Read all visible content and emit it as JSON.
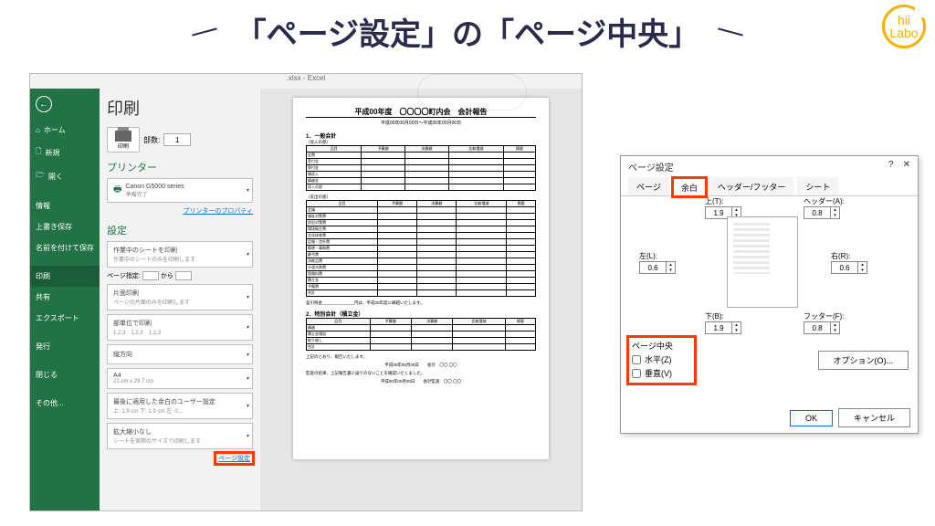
{
  "header": {
    "title": "「ページ設定」の「ページ中央」",
    "logo_text_top": "hii",
    "logo_text_bottom": "Labo"
  },
  "excel": {
    "window_title": ".xlsx - Excel",
    "sidebar": {
      "items": [
        {
          "icon": "←",
          "label": ""
        },
        {
          "label": "ホーム"
        },
        {
          "label": "新規"
        },
        {
          "label": "開く"
        },
        {
          "label": "情報"
        },
        {
          "label": "上書き保存"
        },
        {
          "label": "名前を付けて保存"
        },
        {
          "label": "印刷"
        },
        {
          "label": "共有"
        },
        {
          "label": "エクスポート"
        },
        {
          "label": "発行"
        },
        {
          "label": "閉じる"
        },
        {
          "label": "その他..."
        }
      ]
    },
    "print": {
      "title": "印刷",
      "copies_label": "部数:",
      "copies_value": "1",
      "print_button_label": "印刷",
      "printer_header": "プリンター",
      "printer_name": "Canon G5000 series",
      "printer_status": "準備完了",
      "printer_props_link": "プリンターのプロパティ",
      "settings_header": "設定",
      "settings": [
        {
          "line1": "作業中のシートを印刷",
          "line2": "作業中のシートのみを印刷します"
        },
        {
          "page_range_label1": "ページ指定:",
          "page_range_label2": "から"
        },
        {
          "line1": "片面印刷",
          "line2": "ページの片面のみを印刷します"
        },
        {
          "line1": "部単位で印刷",
          "line2": "1,2,3　1,2,3　1,2,3"
        },
        {
          "line1": "縦方向",
          "line2": ""
        },
        {
          "line1": "A4",
          "line2": "21 cm x 29.7 cm"
        },
        {
          "line1": "最後に適用した余白のユーザー設定",
          "line2": "上: 1.9 cm 下: 1.9 cm 左: 0…"
        },
        {
          "line1": "拡大縮小なし",
          "line2": "シートを実際のサイズで印刷します"
        }
      ],
      "page_setup_link": "ページ設定"
    },
    "preview": {
      "doc_title": "平成00年度　〇〇〇〇町内会　会計報告",
      "doc_sub": "平成00年00月00日～平成00年00月00日",
      "section1": "1．一般会計",
      "section1_sub": "（収入の部）",
      "tbl_head": [
        "品目",
        "予算額",
        "決算額",
        "比較増減",
        "摘要"
      ],
      "income_rows": [
        "会費",
        "受付金",
        "寄付金",
        "雑収入",
        "繰越金",
        "収入の部"
      ],
      "section1_sub2": "（支出の部）",
      "expense_rows": [
        "会議",
        "福祉対策費",
        "防犯対策費",
        "環境衛生費",
        "文化体育費",
        "広報・渉外費",
        "郵便・事務費",
        "慶弔費",
        "消耗品費",
        "水道光熱費",
        "保険料費",
        "積立金",
        "予備費",
        "合計"
      ],
      "note1": "差引残金______________円は、平成00年度に繰越いたします。",
      "section2": "2．特別会計（積立金）",
      "tbl2_rows": [
        "繰越",
        "積立金増加",
        "取り崩し",
        "合計"
      ],
      "note2": "上記のとおり、報告いたします。",
      "note3": "平成00年00月00日　　会計　〇〇 〇〇",
      "note4": "監査の結果、上記報告書に誤りのないことを確認いたしました。",
      "note5": "平成00年00月00日　　会計監査　〇〇 〇〇"
    }
  },
  "dialog": {
    "title": "ページ設定",
    "tabs": [
      "ページ",
      "余白",
      "ヘッダー/フッター",
      "シート"
    ],
    "active_tab": 1,
    "margins": {
      "top": {
        "label": "上(T):",
        "value": "1.9"
      },
      "header": {
        "label": "ヘッダー(A):",
        "value": "0.8"
      },
      "left": {
        "label": "左(L):",
        "value": "0.6"
      },
      "right": {
        "label": "右(R):",
        "value": "0.6"
      },
      "bottom": {
        "label": "下(B):",
        "value": "1.9"
      },
      "footer": {
        "label": "フッター(F):",
        "value": "0.8"
      }
    },
    "page_center_label": "ページ中央",
    "center_horizontal": "水平(Z)",
    "center_vertical": "垂直(V)",
    "options_button": "オプション(O)...",
    "ok_button": "OK",
    "cancel_button": "キャンセル"
  }
}
